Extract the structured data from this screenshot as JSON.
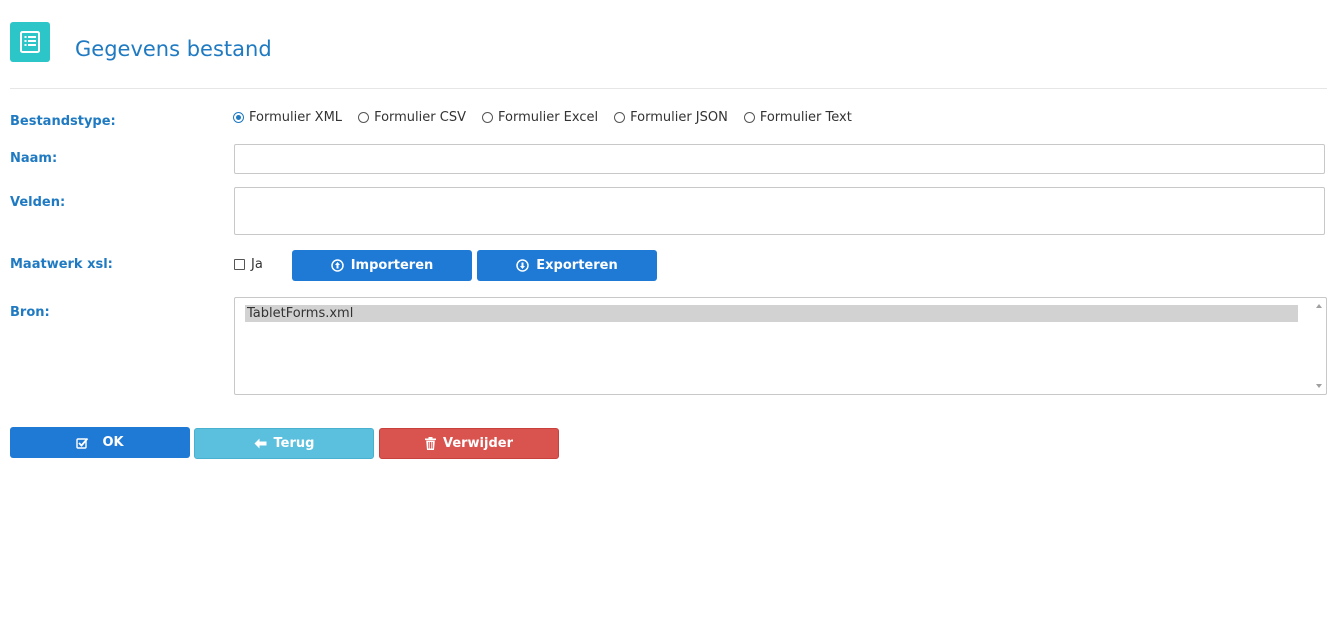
{
  "header": {
    "title": "Gegevens bestand",
    "icon": "list-document-icon",
    "icon_color": "#2dc6c8"
  },
  "form": {
    "bestandstype_label": "Bestandstype:",
    "bestandstype_options": [
      {
        "label": "Formulier XML",
        "checked": true
      },
      {
        "label": "Formulier CSV",
        "checked": false
      },
      {
        "label": "Formulier Excel",
        "checked": false
      },
      {
        "label": "Formulier JSON",
        "checked": false
      },
      {
        "label": "Formulier Text",
        "checked": false
      }
    ],
    "naam_label": "Naam:",
    "naam_value": "",
    "velden_label": "Velden:",
    "velden_value": "",
    "maatwerk_label": "Maatwerk xsl:",
    "maatwerk_checkbox_label": "Ja",
    "maatwerk_checked": false,
    "import_button": "Importeren",
    "export_button": "Exporteren",
    "bron_label": "Bron:",
    "bron_items": [
      "TabletForms.xml"
    ]
  },
  "actions": {
    "ok": "OK",
    "back": "Terug",
    "delete": "Verwijder"
  },
  "colors": {
    "accent": "#1f7ac2",
    "primary_button": "#1f7ad6",
    "info_button": "#5bc0de",
    "danger_button": "#d9534f"
  }
}
